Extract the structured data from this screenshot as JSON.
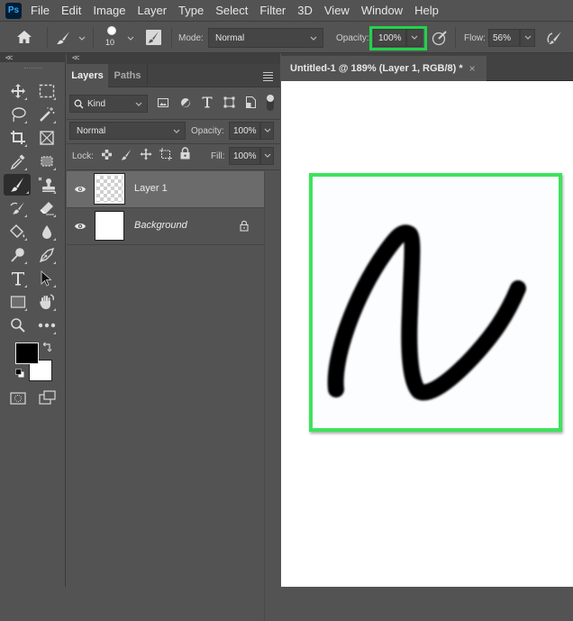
{
  "app": {
    "logo_text": "Ps"
  },
  "menubar": {
    "items": [
      "File",
      "Edit",
      "Image",
      "Layer",
      "Type",
      "Select",
      "Filter",
      "3D",
      "View",
      "Window",
      "Help"
    ]
  },
  "options_bar": {
    "home_icon": "home-icon",
    "tool_preset_icon": "brush-icon",
    "brush_size": "10",
    "brush_settings_icon": "brush-settings-panel-icon",
    "mode_label": "Mode:",
    "mode_value": "Normal",
    "opacity_label": "Opacity:",
    "opacity_value": "100%",
    "pressure_opacity_icon": "pressure-opacity-icon",
    "flow_label": "Flow:",
    "flow_value": "56%",
    "airbrush_icon": "airbrush-icon",
    "highlight_color": "#22d34a"
  },
  "tools_panel": {
    "collapse_label": "<<",
    "tools": [
      [
        "move-tool",
        "rectangular-marquee-tool"
      ],
      [
        "lasso-tool",
        "magic-wand-tool"
      ],
      [
        "crop-tool",
        "frame-tool"
      ],
      [
        "eyedropper-tool",
        "spot-healing-tool"
      ],
      [
        "brush-tool",
        "clone-stamp-tool"
      ],
      [
        "history-brush-tool",
        "eraser-tool"
      ],
      [
        "paint-bucket-tool",
        "blur-tool"
      ],
      [
        "dodge-tool",
        "pen-tool"
      ],
      [
        "type-tool",
        "path-selection-tool"
      ],
      [
        "rectangle-tool",
        "hand-tool"
      ],
      [
        "zoom-tool",
        "edit-toolbar"
      ]
    ],
    "active_tool": "brush-tool",
    "foreground_color": "#000000",
    "background_color": "#ffffff"
  },
  "layers_panel": {
    "collapse_label": "<<",
    "tabs": [
      {
        "label": "Layers",
        "active": true
      },
      {
        "label": "Paths",
        "active": false
      }
    ],
    "filter_kind": "Kind",
    "blend_mode": "Normal",
    "opacity_label": "Opacity:",
    "opacity_value": "100%",
    "lock_label": "Lock:",
    "fill_label": "Fill:",
    "fill_value": "100%",
    "layers": [
      {
        "name": "Layer 1",
        "selected": true,
        "visible": true,
        "locked": false,
        "thumbnail": "transparent"
      },
      {
        "name": "Background",
        "selected": false,
        "visible": true,
        "locked": true,
        "thumbnail": "white"
      }
    ]
  },
  "document": {
    "tab_title": "Untitled-1 @ 189% (Layer 1, RGB/8) *",
    "close_glyph": "×",
    "highlight_color": "#3de35d",
    "stroke_color": "#000000"
  }
}
